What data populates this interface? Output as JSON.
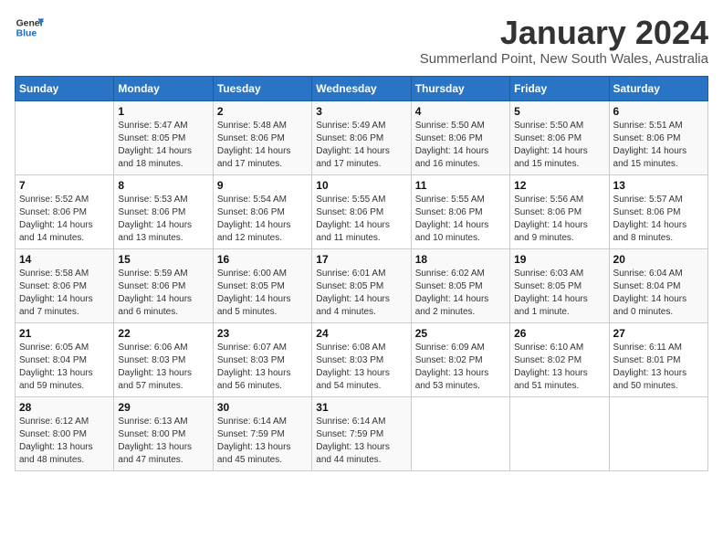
{
  "logo": {
    "text_general": "General",
    "text_blue": "Blue"
  },
  "title": "January 2024",
  "subtitle": "Summerland Point, New South Wales, Australia",
  "days_of_week": [
    "Sunday",
    "Monday",
    "Tuesday",
    "Wednesday",
    "Thursday",
    "Friday",
    "Saturday"
  ],
  "weeks": [
    [
      {
        "day": "",
        "info": ""
      },
      {
        "day": "1",
        "info": "Sunrise: 5:47 AM\nSunset: 8:05 PM\nDaylight: 14 hours\nand 18 minutes."
      },
      {
        "day": "2",
        "info": "Sunrise: 5:48 AM\nSunset: 8:06 PM\nDaylight: 14 hours\nand 17 minutes."
      },
      {
        "day": "3",
        "info": "Sunrise: 5:49 AM\nSunset: 8:06 PM\nDaylight: 14 hours\nand 17 minutes."
      },
      {
        "day": "4",
        "info": "Sunrise: 5:50 AM\nSunset: 8:06 PM\nDaylight: 14 hours\nand 16 minutes."
      },
      {
        "day": "5",
        "info": "Sunrise: 5:50 AM\nSunset: 8:06 PM\nDaylight: 14 hours\nand 15 minutes."
      },
      {
        "day": "6",
        "info": "Sunrise: 5:51 AM\nSunset: 8:06 PM\nDaylight: 14 hours\nand 15 minutes."
      }
    ],
    [
      {
        "day": "7",
        "info": "Sunrise: 5:52 AM\nSunset: 8:06 PM\nDaylight: 14 hours\nand 14 minutes."
      },
      {
        "day": "8",
        "info": "Sunrise: 5:53 AM\nSunset: 8:06 PM\nDaylight: 14 hours\nand 13 minutes."
      },
      {
        "day": "9",
        "info": "Sunrise: 5:54 AM\nSunset: 8:06 PM\nDaylight: 14 hours\nand 12 minutes."
      },
      {
        "day": "10",
        "info": "Sunrise: 5:55 AM\nSunset: 8:06 PM\nDaylight: 14 hours\nand 11 minutes."
      },
      {
        "day": "11",
        "info": "Sunrise: 5:55 AM\nSunset: 8:06 PM\nDaylight: 14 hours\nand 10 minutes."
      },
      {
        "day": "12",
        "info": "Sunrise: 5:56 AM\nSunset: 8:06 PM\nDaylight: 14 hours\nand 9 minutes."
      },
      {
        "day": "13",
        "info": "Sunrise: 5:57 AM\nSunset: 8:06 PM\nDaylight: 14 hours\nand 8 minutes."
      }
    ],
    [
      {
        "day": "14",
        "info": "Sunrise: 5:58 AM\nSunset: 8:06 PM\nDaylight: 14 hours\nand 7 minutes."
      },
      {
        "day": "15",
        "info": "Sunrise: 5:59 AM\nSunset: 8:06 PM\nDaylight: 14 hours\nand 6 minutes."
      },
      {
        "day": "16",
        "info": "Sunrise: 6:00 AM\nSunset: 8:05 PM\nDaylight: 14 hours\nand 5 minutes."
      },
      {
        "day": "17",
        "info": "Sunrise: 6:01 AM\nSunset: 8:05 PM\nDaylight: 14 hours\nand 4 minutes."
      },
      {
        "day": "18",
        "info": "Sunrise: 6:02 AM\nSunset: 8:05 PM\nDaylight: 14 hours\nand 2 minutes."
      },
      {
        "day": "19",
        "info": "Sunrise: 6:03 AM\nSunset: 8:05 PM\nDaylight: 14 hours\nand 1 minute."
      },
      {
        "day": "20",
        "info": "Sunrise: 6:04 AM\nSunset: 8:04 PM\nDaylight: 14 hours\nand 0 minutes."
      }
    ],
    [
      {
        "day": "21",
        "info": "Sunrise: 6:05 AM\nSunset: 8:04 PM\nDaylight: 13 hours\nand 59 minutes."
      },
      {
        "day": "22",
        "info": "Sunrise: 6:06 AM\nSunset: 8:03 PM\nDaylight: 13 hours\nand 57 minutes."
      },
      {
        "day": "23",
        "info": "Sunrise: 6:07 AM\nSunset: 8:03 PM\nDaylight: 13 hours\nand 56 minutes."
      },
      {
        "day": "24",
        "info": "Sunrise: 6:08 AM\nSunset: 8:03 PM\nDaylight: 13 hours\nand 54 minutes."
      },
      {
        "day": "25",
        "info": "Sunrise: 6:09 AM\nSunset: 8:02 PM\nDaylight: 13 hours\nand 53 minutes."
      },
      {
        "day": "26",
        "info": "Sunrise: 6:10 AM\nSunset: 8:02 PM\nDaylight: 13 hours\nand 51 minutes."
      },
      {
        "day": "27",
        "info": "Sunrise: 6:11 AM\nSunset: 8:01 PM\nDaylight: 13 hours\nand 50 minutes."
      }
    ],
    [
      {
        "day": "28",
        "info": "Sunrise: 6:12 AM\nSunset: 8:00 PM\nDaylight: 13 hours\nand 48 minutes."
      },
      {
        "day": "29",
        "info": "Sunrise: 6:13 AM\nSunset: 8:00 PM\nDaylight: 13 hours\nand 47 minutes."
      },
      {
        "day": "30",
        "info": "Sunrise: 6:14 AM\nSunset: 7:59 PM\nDaylight: 13 hours\nand 45 minutes."
      },
      {
        "day": "31",
        "info": "Sunrise: 6:14 AM\nSunset: 7:59 PM\nDaylight: 13 hours\nand 44 minutes."
      },
      {
        "day": "",
        "info": ""
      },
      {
        "day": "",
        "info": ""
      },
      {
        "day": "",
        "info": ""
      }
    ]
  ]
}
